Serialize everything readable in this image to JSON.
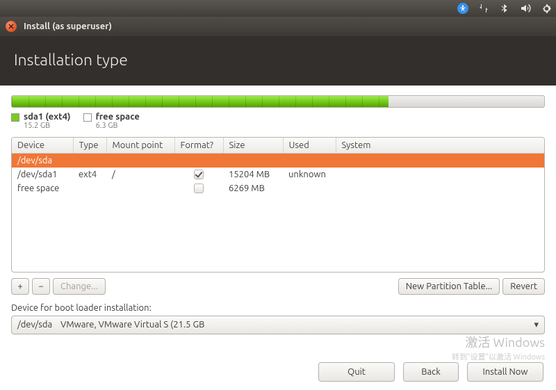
{
  "tray": {
    "icons": [
      "accessibility-icon",
      "network-icon",
      "bluetooth-icon",
      "volume-icon",
      "gear-icon"
    ]
  },
  "window": {
    "title": "Install (as superuser)",
    "page_title": "Installation type"
  },
  "usage": {
    "used_pct": 70.7,
    "legend": [
      {
        "label": "sda1 (ext4)",
        "size": "15.2 GB",
        "color": "green"
      },
      {
        "label": "free space",
        "size": "6.3 GB",
        "color": "empty"
      }
    ]
  },
  "table": {
    "headers": [
      "Device",
      "Type",
      "Mount point",
      "Format?",
      "Size",
      "Used",
      "System"
    ],
    "rows": [
      {
        "device": "/dev/sda",
        "type": "",
        "mount": "",
        "format": null,
        "size": "",
        "used": "",
        "system": "",
        "selected": true
      },
      {
        "device": "/dev/sda1",
        "type": "ext4",
        "mount": "/",
        "format": true,
        "size": "15204 MB",
        "used": "unknown",
        "system": "",
        "selected": false
      },
      {
        "device": "free space",
        "type": "",
        "mount": "",
        "format": false,
        "size": "6269 MB",
        "used": "",
        "system": "",
        "selected": false
      }
    ]
  },
  "toolbar": {
    "add": "+",
    "remove": "−",
    "change": "Change...",
    "new_table": "New Partition Table...",
    "revert": "Revert"
  },
  "boot": {
    "label": "Device for boot loader installation:",
    "value": "/dev/sda    VMware, VMware Virtual S (21.5 GB"
  },
  "footer": {
    "quit": "Quit",
    "back": "Back",
    "install": "Install Now"
  },
  "watermark": {
    "line1": "激活 Windows",
    "line2": "转到\"设置\"以激活 Windows"
  }
}
